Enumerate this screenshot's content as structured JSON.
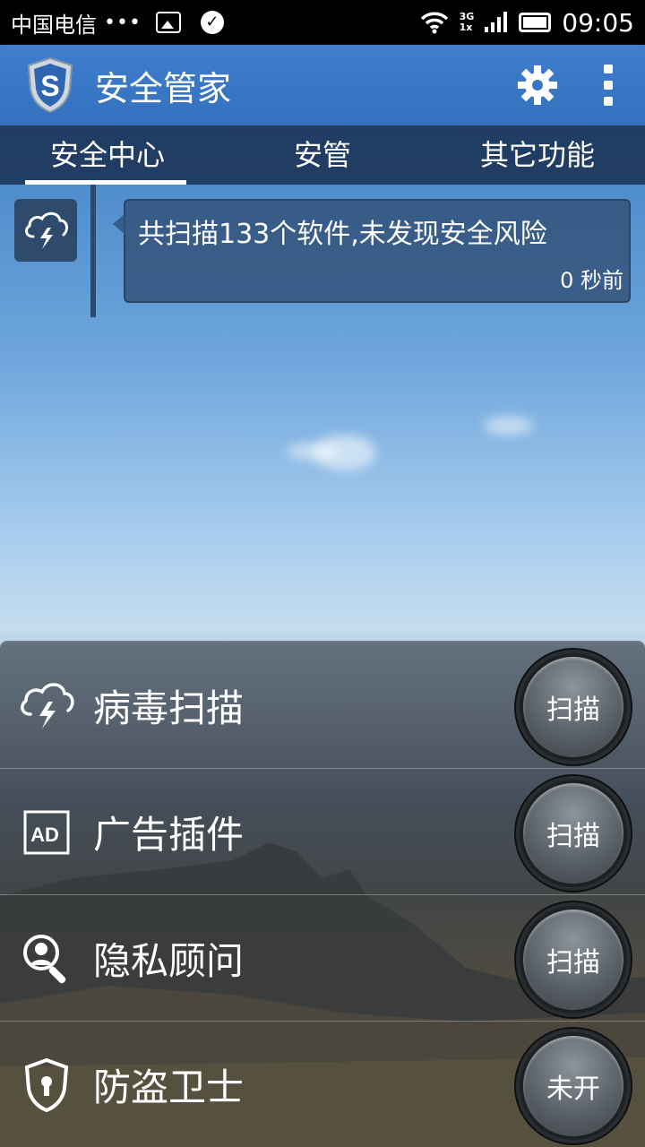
{
  "status_bar": {
    "carrier": "中国电信",
    "dots": "•••",
    "network_top": "3G",
    "network_bottom": "1x",
    "time": "09:05"
  },
  "app_bar": {
    "title": "安全管家",
    "logo_letter": "S"
  },
  "tabs": [
    {
      "label": "安全中心",
      "active": true
    },
    {
      "label": "安管",
      "active": false
    },
    {
      "label": "其它功能",
      "active": false
    }
  ],
  "feed": {
    "message": "共扫描133个软件,未发现安全风险",
    "time": "0 秒前"
  },
  "tools": [
    {
      "label": "病毒扫描",
      "icon": "cloud-bolt-icon",
      "button": "扫描"
    },
    {
      "label": "广告插件",
      "icon": "ad-icon",
      "button": "扫描",
      "icon_text": "AD"
    },
    {
      "label": "隐私顾问",
      "icon": "privacy-search-icon",
      "button": "扫描"
    },
    {
      "label": "防盗卫士",
      "icon": "shield-lock-icon",
      "button": "未开"
    }
  ]
}
